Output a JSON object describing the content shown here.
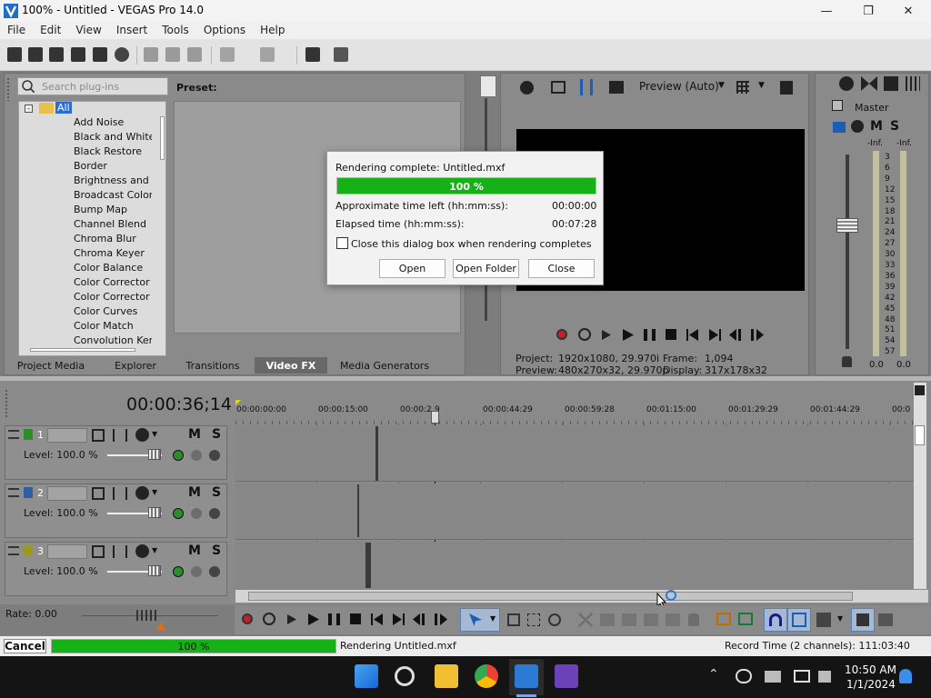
{
  "window": {
    "title": "100% - Untitled - VEGAS Pro 14.0"
  },
  "menu": [
    "File",
    "Edit",
    "View",
    "Insert",
    "Tools",
    "Options",
    "Help"
  ],
  "plugins": {
    "search_placeholder": "Search plug-ins",
    "preset_label": "Preset:",
    "root": "All",
    "items": [
      "Add Noise",
      "Black and White",
      "Black Restore",
      "Border",
      "Brightness and Co",
      "Broadcast Colors",
      "Bump Map",
      "Channel Blend",
      "Chroma Blur",
      "Chroma Keyer",
      "Color Balance",
      "Color Corrector",
      "Color Corrector (S",
      "Color Curves",
      "Color Match",
      "Convolution Kerne"
    ]
  },
  "tabs": [
    "Project Media",
    "Explorer",
    "Transitions",
    "Video FX",
    "Media Generators"
  ],
  "active_tab": "Video FX",
  "preview": {
    "mode": "Preview (Auto)",
    "project_label": "Project:",
    "project_value": "1920x1080, 29.970i",
    "preview_label": "Preview:",
    "preview_value": "480x270x32, 29.970p",
    "frame_label": "Frame:",
    "frame_value": "1,094",
    "display_label": "Display:",
    "display_value": "317x178x32"
  },
  "mixer": {
    "master": "Master",
    "m": "M",
    "s": "S",
    "left_peak": "-Inf.",
    "right_peak": "-Inf.",
    "scale": [
      "3",
      "6",
      "9",
      "12",
      "15",
      "18",
      "21",
      "24",
      "27",
      "30",
      "33",
      "36",
      "39",
      "42",
      "45",
      "48",
      "51",
      "54",
      "57"
    ],
    "left_value": "0.0",
    "right_value": "0.0"
  },
  "dialog": {
    "heading": "Rendering complete: Untitled.mxf",
    "progress_text": "100 %",
    "progress": 1.0,
    "time_left_label": "Approximate time left (hh:mm:ss):",
    "time_left_value": "00:00:00",
    "elapsed_label": "Elapsed time (hh:mm:ss):",
    "elapsed_value": "00:07:28",
    "checkbox_label": "Close this dialog box when rendering completes",
    "open_button": "Open",
    "open_folder_button": "Open Folder",
    "close_button": "Close"
  },
  "timeline": {
    "timecode": "00:00:36;14",
    "ticks": [
      "00:00:00:00",
      "00:00:15:00",
      "00:00:2",
      "9",
      "00:00:44:29",
      "00:00:59:28",
      "00:01:15:00",
      "00:01:29:29",
      "00:01:44:29",
      "00:0"
    ],
    "tracks": [
      {
        "num": "1",
        "level": "Level: 100.0 %"
      },
      {
        "num": "2",
        "level": "Level: 100.0 %"
      },
      {
        "num": "3",
        "level": "Level: 100.0 %"
      }
    ],
    "m": "M",
    "s": "S",
    "rate": "Rate: 0.00"
  },
  "status": {
    "cancel": "Cancel",
    "progress_text": "100 %",
    "progress": 1.0,
    "message": "Rendering Untitled.mxf",
    "record_time": "Record Time (2 channels): 111:03:40"
  },
  "taskbar": {
    "time": "10:50 AM",
    "date": "1/1/2024"
  },
  "colors": {
    "accent_green": "#16b116",
    "taskbar": "#141414",
    "vegas_blue": "#2b7bd6"
  }
}
